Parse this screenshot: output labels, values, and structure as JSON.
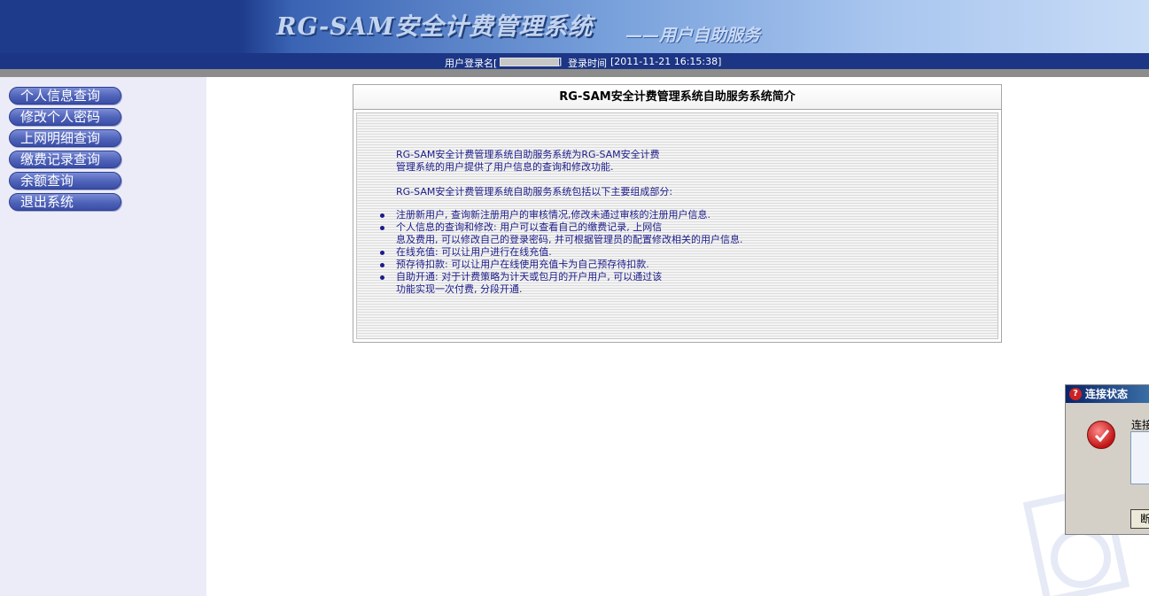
{
  "header": {
    "title": "RG-SAM安全计费管理系统",
    "subtitle": "——用户自助服务"
  },
  "infobar": {
    "login_name_label": "用户登录名[",
    "login_name_close": "]",
    "login_time_label": "登录时间",
    "login_time_value": "[2011-11-21 16:15:38]"
  },
  "sidebar": {
    "items": [
      {
        "label": "个人信息查询"
      },
      {
        "label": "修改个人密码"
      },
      {
        "label": "上网明细查询"
      },
      {
        "label": "缴费记录查询"
      },
      {
        "label": "余额查询"
      },
      {
        "label": "退出系统"
      }
    ]
  },
  "panel": {
    "title": "RG-SAM安全计费管理系统自助服务系统简介",
    "intro_line1": " RG-SAM安全计费管理系统自助服务系统为RG-SAM安全计费",
    "intro_line2": "管理系统的用户提供了用户信息的查询和修改功能.",
    "intro_line3": "RG-SAM安全计费管理系统自助服务系统包括以下主要组成部分:",
    "bullets": [
      {
        "line1": "注册新用户, 查询新注册用户的审核情况,修改未通过审核的注册用户信息.",
        "line2": ""
      },
      {
        "line1": "个人信息的查询和修改: 用户可以查看自己的缴费记录, 上网信",
        "line2": "息及费用, 可以修改自己的登录密码, 并可根据管理员的配置修改相关的用户信息."
      },
      {
        "line1": "在线充值: 可以让用户进行在线充值.",
        "line2": ""
      },
      {
        "line1": "预存待扣款: 可以让用户在线使用充值卡为自己预存待扣款.",
        "line2": ""
      },
      {
        "line1": "自助开通: 对于计费策略为计天或包月的开户用户, 可以通过该",
        "line2": "功能实现一次付费, 分段开通."
      }
    ]
  },
  "popup": {
    "title": "连接状态",
    "label": "连接",
    "button_label": "断"
  }
}
